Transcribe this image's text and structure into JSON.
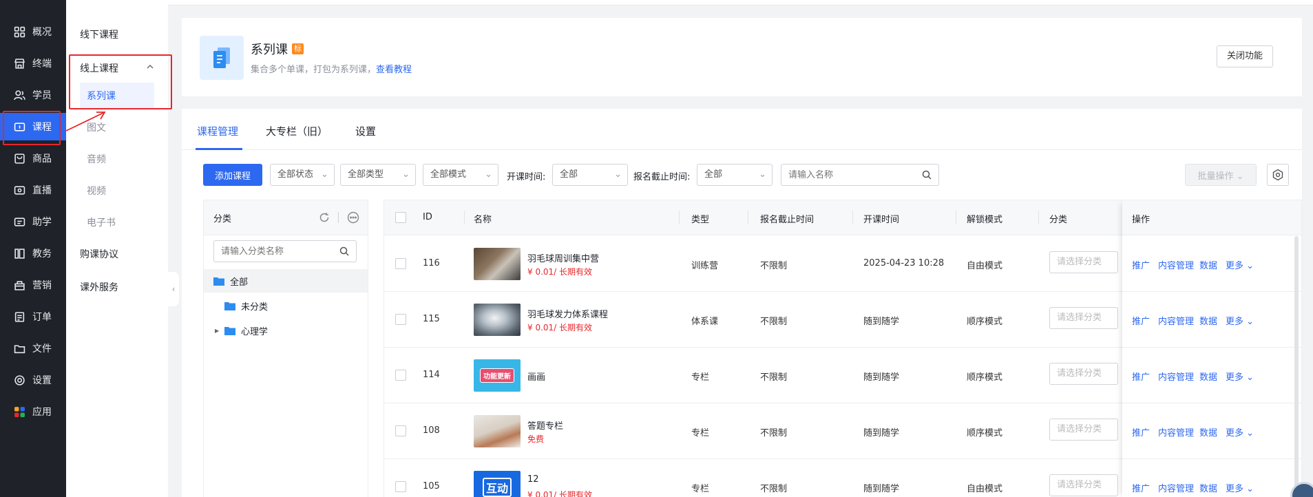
{
  "rail": {
    "items": [
      {
        "label": "概况",
        "icon": "grid-icon"
      },
      {
        "label": "终端",
        "icon": "store-icon"
      },
      {
        "label": "学员",
        "icon": "users-icon"
      },
      {
        "label": "课程",
        "icon": "course-icon",
        "active": true
      },
      {
        "label": "商品",
        "icon": "bag-icon"
      },
      {
        "label": "直播",
        "icon": "live-icon"
      },
      {
        "label": "助学",
        "icon": "study-icon"
      },
      {
        "label": "教务",
        "icon": "book-icon"
      },
      {
        "label": "营销",
        "icon": "marketing-icon"
      },
      {
        "label": "订单",
        "icon": "order-icon"
      },
      {
        "label": "文件",
        "icon": "folder-icon"
      },
      {
        "label": "设置",
        "icon": "gear-icon"
      },
      {
        "label": "应用",
        "icon": "apps-icon"
      }
    ]
  },
  "submenu": {
    "offline": "线下课程",
    "online": "线上课程",
    "series": "系列课",
    "subs": [
      "图文",
      "音频",
      "视频",
      "电子书"
    ],
    "purchase": "购课协议",
    "extra": "课外服务"
  },
  "hero": {
    "title": "系列课",
    "tag": "标",
    "desc": "集合多个单课，打包为系列课，",
    "link": "查看教程",
    "close_btn": "关闭功能"
  },
  "tabs": [
    "课程管理",
    "大专栏（旧）",
    "设置"
  ],
  "toolbar": {
    "add": "添加课程",
    "status": "全部状态",
    "type": "全部类型",
    "mode": "全部模式",
    "start_label": "开课时间:",
    "start_value": "全部",
    "deadline_label": "报名截止时间:",
    "deadline_value": "全部",
    "search_placeholder": "请输入名称",
    "batch": "批量操作"
  },
  "category": {
    "title": "分类",
    "search_placeholder": "请输入分类名称",
    "items": [
      "全部",
      "未分类",
      "心理学"
    ]
  },
  "table": {
    "headers": [
      "ID",
      "名称",
      "类型",
      "报名截止时间",
      "开课时间",
      "解锁模式",
      "分类",
      "操作"
    ],
    "category_placeholder": "请选择分类",
    "ops": [
      "推广",
      "内容管理",
      "数据",
      "更多"
    ],
    "rows": [
      {
        "id": "116",
        "name": "羽毛球周训集中营",
        "price": "¥ 0.01/ 长期有效",
        "type": "训练营",
        "deadline": "不限制",
        "start": "2025-04-23 10:28",
        "mode": "自由模式"
      },
      {
        "id": "115",
        "name": "羽毛球发力体系课程",
        "price": "¥ 0.01/ 长期有效",
        "type": "体系课",
        "deadline": "不限制",
        "start": "随到随学",
        "mode": "顺序模式"
      },
      {
        "id": "114",
        "name": "画画",
        "price": "",
        "type": "专栏",
        "deadline": "不限制",
        "start": "随到随学",
        "mode": "顺序模式"
      },
      {
        "id": "108",
        "name": "答题专栏",
        "price": "免费",
        "type": "专栏",
        "deadline": "不限制",
        "start": "随到随学",
        "mode": "顺序模式"
      },
      {
        "id": "105",
        "name": "12",
        "price": "¥ 0.01/ 长期有效",
        "type": "专栏",
        "deadline": "不限制",
        "start": "随到随学",
        "mode": "自由模式"
      }
    ]
  },
  "thumb_text": {
    "t114": "功能更新",
    "t105": "互动"
  },
  "colors": {
    "accent": "#2d68f0",
    "price": "#e8262a",
    "rail": "#1f2329",
    "highlight": "#e8262a"
  }
}
